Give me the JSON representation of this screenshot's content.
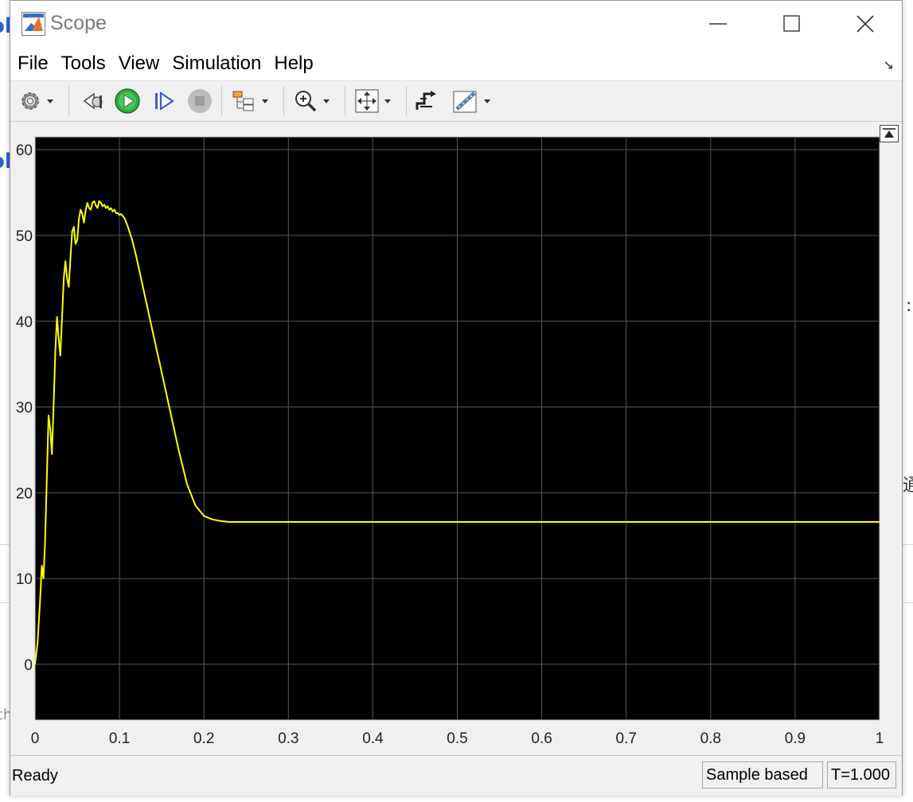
{
  "window": {
    "title": "Scope",
    "undock_symbol": "↘"
  },
  "menu": [
    "File",
    "Tools",
    "View",
    "Simulation",
    "Help"
  ],
  "toolbar": {
    "buttons": [
      {
        "icon": "gear-icon",
        "dropdown": true
      },
      {
        "icon": "step-back-icon",
        "dropdown": false
      },
      {
        "icon": "run-icon",
        "dropdown": false
      },
      {
        "icon": "step-forward-icon",
        "dropdown": false
      },
      {
        "icon": "stop-icon",
        "dropdown": false
      },
      {
        "icon": "signal-hierarchy-icon",
        "dropdown": true
      },
      {
        "icon": "zoom-in-icon",
        "dropdown": true
      },
      {
        "icon": "autoscale-icon",
        "dropdown": true
      },
      {
        "icon": "trigger-icon",
        "dropdown": false
      },
      {
        "icon": "cursor-measure-icon",
        "dropdown": true
      }
    ]
  },
  "status": {
    "text": "Ready",
    "mode": "Sample based",
    "time": "T=1.000"
  },
  "background_fragments": {
    "left_top": "ol",
    "left_mid": "ol",
    "right_mid": ":",
    "right_low": "通",
    "left_low": "ch"
  },
  "colors": {
    "plot_bg": "#000000",
    "grid": "#5a5a5a",
    "trace": "#ffff00",
    "accent": "#2a62d4"
  },
  "chart_data": {
    "type": "line",
    "xlim": [
      0,
      1
    ],
    "ylim": [
      -6.5,
      61.5
    ],
    "xticks": [
      "0",
      "0.1",
      "0.2",
      "0.3",
      "0.4",
      "0.5",
      "0.6",
      "0.7",
      "0.8",
      "0.9",
      "1"
    ],
    "yticks": [
      "0",
      "10",
      "20",
      "30",
      "40",
      "50",
      "60"
    ],
    "grid": true,
    "series": [
      {
        "color": "#ffff00",
        "x": [
          0,
          0.003,
          0.006,
          0.008,
          0.01,
          0.012,
          0.014,
          0.016,
          0.018,
          0.02,
          0.022,
          0.024,
          0.026,
          0.028,
          0.03,
          0.032,
          0.034,
          0.036,
          0.038,
          0.04,
          0.042,
          0.044,
          0.046,
          0.048,
          0.05,
          0.052,
          0.054,
          0.056,
          0.058,
          0.06,
          0.062,
          0.064,
          0.066,
          0.068,
          0.07,
          0.072,
          0.074,
          0.076,
          0.078,
          0.08,
          0.082,
          0.084,
          0.086,
          0.088,
          0.09,
          0.092,
          0.094,
          0.096,
          0.098,
          0.1,
          0.102,
          0.106,
          0.11,
          0.115,
          0.12,
          0.13,
          0.14,
          0.15,
          0.16,
          0.17,
          0.18,
          0.19,
          0.2,
          0.21,
          0.22,
          0.23,
          0.24,
          0.25,
          0.26,
          0.27,
          0.28,
          0.29,
          0.3,
          0.32,
          0.35,
          0.4,
          0.5,
          0.6,
          0.7,
          0.8,
          0.9,
          1.0
        ],
        "y": [
          0,
          2.5,
          7.5,
          11.5,
          10.0,
          14.5,
          22.0,
          29.0,
          27.5,
          24.5,
          30.0,
          36.5,
          40.5,
          38.0,
          36.0,
          40.5,
          45.0,
          47.0,
          45.0,
          44.0,
          47.5,
          50.5,
          51.0,
          49.0,
          49.5,
          52.0,
          53.0,
          52.5,
          51.5,
          53.0,
          53.8,
          53.2,
          53.0,
          53.8,
          54.0,
          53.5,
          53.2,
          54.0,
          53.8,
          53.4,
          53.6,
          53.2,
          53.4,
          53.0,
          53.2,
          52.8,
          53.0,
          52.6,
          52.6,
          52.4,
          52.5,
          52.0,
          51.0,
          49.5,
          47.5,
          43.0,
          38.5,
          34.0,
          29.5,
          25.0,
          21.0,
          18.5,
          17.3,
          16.9,
          16.7,
          16.6,
          16.6,
          16.6,
          16.6,
          16.6,
          16.6,
          16.6,
          16.6,
          16.6,
          16.6,
          16.6,
          16.6,
          16.6,
          16.6,
          16.6,
          16.6,
          16.6
        ]
      }
    ]
  }
}
